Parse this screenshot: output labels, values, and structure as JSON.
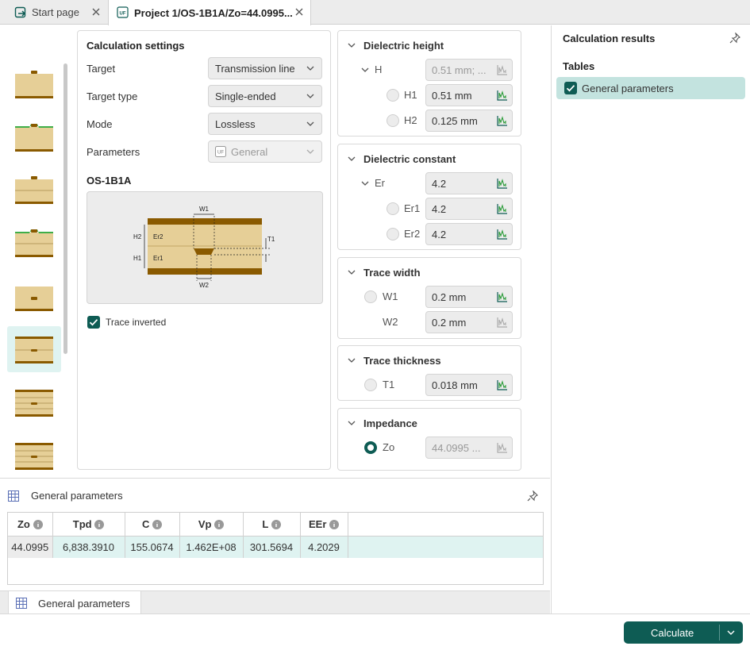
{
  "tabs": [
    {
      "label": "Start page",
      "icon": "start-page-icon"
    },
    {
      "label": "Project 1/OS-1B1A/Zo=44.0995...",
      "icon": "uf-icon",
      "badge": "UF"
    }
  ],
  "settings": {
    "title": "Calculation settings",
    "rows": [
      {
        "label": "Target",
        "value": "Transmission line"
      },
      {
        "label": "Target type",
        "value": "Single-ended"
      },
      {
        "label": "Mode",
        "value": "Lossless"
      },
      {
        "label": "Parameters",
        "value": "General",
        "badge": "UF"
      }
    ],
    "model_title": "OS-1B1A",
    "diagram_labels": {
      "w1": "W1",
      "w2": "W2",
      "h1": "H1",
      "h2": "H2",
      "er1": "Er1",
      "er2": "Er2",
      "t1": "T1"
    },
    "trace_inverted_label": "Trace inverted",
    "trace_inverted_checked": true
  },
  "groups": {
    "dielectric_height": {
      "title": "Dielectric height",
      "parent": {
        "label": "H",
        "value": "0.51 mm; ..."
      },
      "children": [
        {
          "label": "H1",
          "value": "0.51 mm"
        },
        {
          "label": "H2",
          "value": "0.125 mm"
        }
      ]
    },
    "dielectric_constant": {
      "title": "Dielectric constant",
      "parent": {
        "label": "Er",
        "value": "4.2"
      },
      "children": [
        {
          "label": "Er1",
          "value": "4.2"
        },
        {
          "label": "Er2",
          "value": "4.2"
        }
      ]
    },
    "trace_width": {
      "title": "Trace width",
      "items": [
        {
          "label": "W1",
          "value": "0.2 mm"
        },
        {
          "label": "W2",
          "value": "0.2 mm"
        }
      ]
    },
    "trace_thickness": {
      "title": "Trace thickness",
      "items": [
        {
          "label": "T1",
          "value": "0.018 mm"
        }
      ]
    },
    "impedance": {
      "title": "Impedance",
      "items": [
        {
          "label": "Zo",
          "value": "44.0995 ..."
        }
      ]
    }
  },
  "results": {
    "title": "Calculation results",
    "section": "Tables",
    "item": "General parameters"
  },
  "table": {
    "title": "General parameters",
    "columns": [
      "Zo",
      "Tpd",
      "C",
      "Vp",
      "L",
      "EEr"
    ],
    "rows": [
      [
        "44.0995",
        "6,838.3910",
        "155.0674",
        "1.462E+08",
        "301.5694",
        "4.2029"
      ]
    ]
  },
  "bottom_tab": "General parameters",
  "calculate_label": "Calculate",
  "colors": {
    "accent": "#0e5c54",
    "selection": "#dff3f1",
    "panel_gray": "#ececec",
    "copper": "#8a5a00",
    "dielectric": "#e6cf97",
    "solder_mask": "#3fae49"
  }
}
